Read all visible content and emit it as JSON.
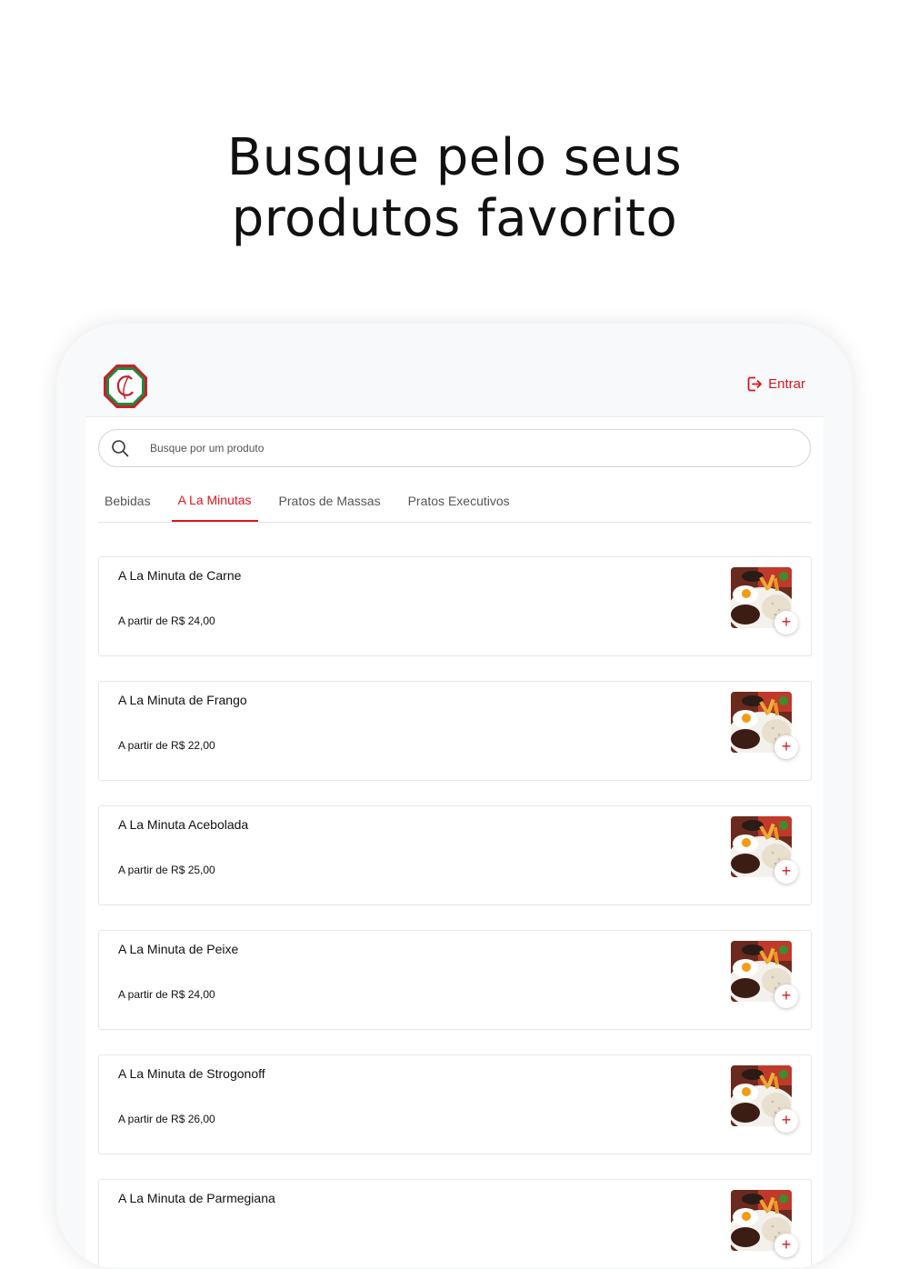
{
  "headline": {
    "line1": "Busque pelo seus",
    "line2": "produtos favorito"
  },
  "header": {
    "logo_icon": "restaurant-logo-icon",
    "login_label": "Entrar",
    "login_icon": "login-icon"
  },
  "search": {
    "placeholder": "Busque por um produto",
    "icon": "search-icon"
  },
  "tabs": [
    {
      "label": "Bebidas",
      "active": false
    },
    {
      "label": "A La Minutas",
      "active": true
    },
    {
      "label": "Pratos de Massas",
      "active": false
    },
    {
      "label": "Pratos Executivos",
      "active": false
    }
  ],
  "products": [
    {
      "name": "A La Minuta de Carne",
      "price": "A partir de R$ 24,00"
    },
    {
      "name": "A La Minuta de Frango",
      "price": "A partir de R$ 22,00"
    },
    {
      "name": "A La Minuta Acebolada",
      "price": "A partir de R$ 25,00"
    },
    {
      "name": "A La Minuta de Peixe",
      "price": "A partir de R$ 24,00"
    },
    {
      "name": "A La Minuta de Strogonoff",
      "price": "A partir de R$ 26,00"
    },
    {
      "name": "A La Minuta de Parmegiana",
      "price": ""
    }
  ],
  "add_button_label": "+",
  "colors": {
    "accent": "#e0141f",
    "topbar_bg": "#f8f9fa",
    "border": "#e6e6e6"
  }
}
